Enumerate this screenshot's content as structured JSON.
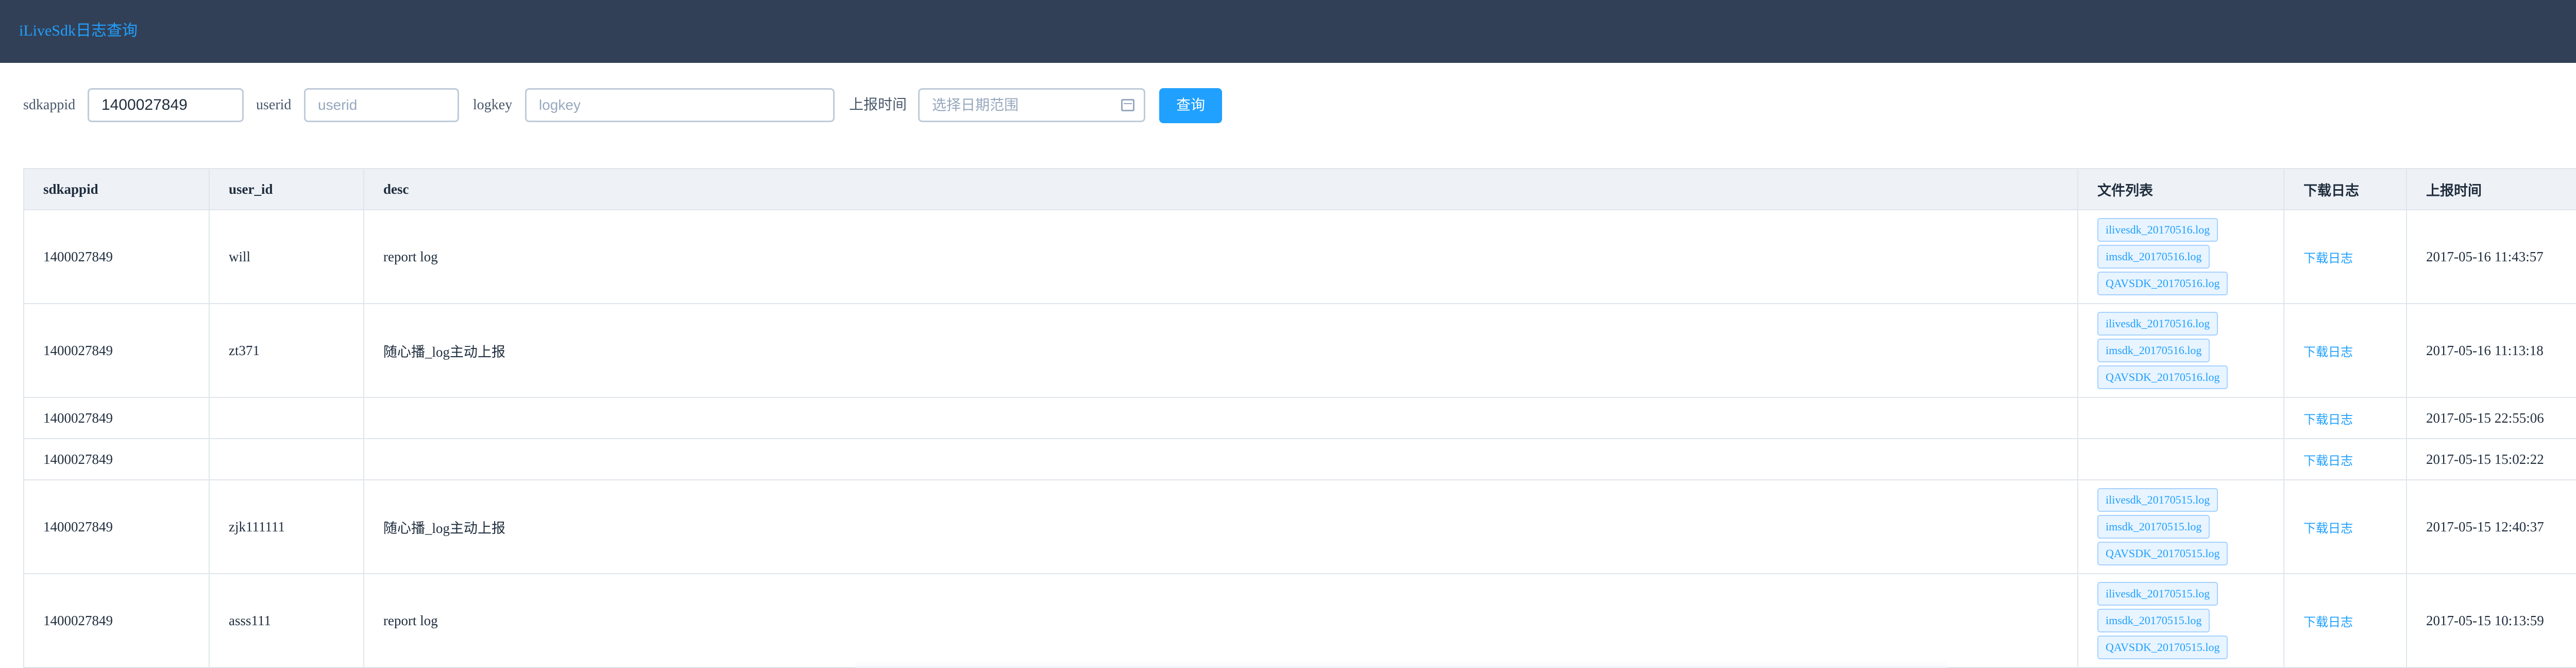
{
  "app": {
    "title": "iLiveSdk日志查询"
  },
  "filters": {
    "sdkappid_label": "sdkappid",
    "sdkappid_value": "1400027849",
    "userid_label": "userid",
    "userid_placeholder": "userid",
    "logkey_label": "logkey",
    "logkey_placeholder": "logkey",
    "time_label": "上报时间",
    "date_placeholder": "选择日期范围",
    "calendar_icon": "calendar-icon",
    "query_button": "查询"
  },
  "table": {
    "columns": [
      "sdkappid",
      "user_id",
      "desc",
      "文件列表",
      "下载日志",
      "上报时间"
    ],
    "rows": [
      {
        "sdkappid": "1400027849",
        "user_id": "will",
        "desc": "report log",
        "files": [
          "ilivesdk_20170516.log",
          "imsdk_20170516.log",
          "QAVSDK_20170516.log"
        ],
        "download": "下载日志",
        "time": "2017-05-16 11:43:57"
      },
      {
        "sdkappid": "1400027849",
        "user_id": "zt371",
        "desc": "随心播_log主动上报",
        "files": [
          "ilivesdk_20170516.log",
          "imsdk_20170516.log",
          "QAVSDK_20170516.log"
        ],
        "download": "下载日志",
        "time": "2017-05-16 11:13:18"
      },
      {
        "sdkappid": "1400027849",
        "user_id": "",
        "desc": "",
        "files": [],
        "download": "下载日志",
        "time": "2017-05-15 22:55:06"
      },
      {
        "sdkappid": "1400027849",
        "user_id": "",
        "desc": "",
        "files": [],
        "download": "下载日志",
        "time": "2017-05-15 15:02:22"
      },
      {
        "sdkappid": "1400027849",
        "user_id": "zjk111111",
        "desc": "随心播_log主动上报",
        "files": [
          "ilivesdk_20170515.log",
          "imsdk_20170515.log",
          "QAVSDK_20170515.log"
        ],
        "download": "下载日志",
        "time": "2017-05-15 12:40:37"
      },
      {
        "sdkappid": "1400027849",
        "user_id": "asss111",
        "desc": "report log",
        "files": [
          "ilivesdk_20170515.log",
          "imsdk_20170515.log",
          "QAVSDK_20170515.log"
        ],
        "download": "下载日志",
        "time": "2017-05-15 10:13:59"
      }
    ]
  },
  "colors": {
    "header_bg": "#324057",
    "accent": "#20a0ff",
    "table_header_bg": "#eef1f6",
    "border": "#dfe6ec"
  }
}
